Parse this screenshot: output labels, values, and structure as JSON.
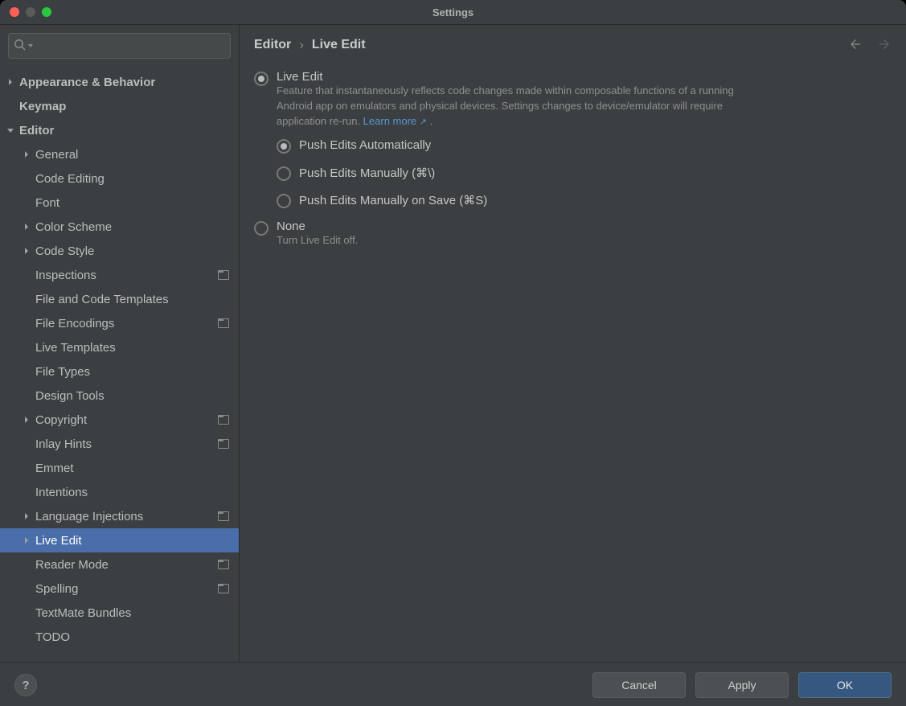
{
  "window": {
    "title": "Settings"
  },
  "sidebar": {
    "search_placeholder": "",
    "items": [
      {
        "label": "Appearance & Behavior",
        "depth": 0,
        "chevron": "right",
        "bold": true
      },
      {
        "label": "Keymap",
        "depth": 0,
        "bold": true
      },
      {
        "label": "Editor",
        "depth": 0,
        "chevron": "down",
        "bold": true
      },
      {
        "label": "General",
        "depth": 1,
        "chevron": "right"
      },
      {
        "label": "Code Editing",
        "depth": 1
      },
      {
        "label": "Font",
        "depth": 1
      },
      {
        "label": "Color Scheme",
        "depth": 1,
        "chevron": "right"
      },
      {
        "label": "Code Style",
        "depth": 1,
        "chevron": "right"
      },
      {
        "label": "Inspections",
        "depth": 1,
        "badge": true
      },
      {
        "label": "File and Code Templates",
        "depth": 1
      },
      {
        "label": "File Encodings",
        "depth": 1,
        "badge": true
      },
      {
        "label": "Live Templates",
        "depth": 1
      },
      {
        "label": "File Types",
        "depth": 1
      },
      {
        "label": "Design Tools",
        "depth": 1
      },
      {
        "label": "Copyright",
        "depth": 1,
        "chevron": "right",
        "badge": true
      },
      {
        "label": "Inlay Hints",
        "depth": 1,
        "badge": true
      },
      {
        "label": "Emmet",
        "depth": 1
      },
      {
        "label": "Intentions",
        "depth": 1
      },
      {
        "label": "Language Injections",
        "depth": 1,
        "chevron": "right",
        "badge": true
      },
      {
        "label": "Live Edit",
        "depth": 1,
        "chevron": "right",
        "selected": true
      },
      {
        "label": "Reader Mode",
        "depth": 1,
        "badge": true
      },
      {
        "label": "Spelling",
        "depth": 1,
        "badge": true
      },
      {
        "label": "TextMate Bundles",
        "depth": 1
      },
      {
        "label": "TODO",
        "depth": 1
      }
    ]
  },
  "breadcrumb": {
    "part1": "Editor",
    "sep": "›",
    "part2": "Live Edit"
  },
  "options": {
    "liveEdit": {
      "label": "Live Edit",
      "desc_before": "Feature that instantaneously reflects code changes made within composable functions of a running Android app on emulators and physical devices. Settings changes to device/emulator will require application re-run. ",
      "learn_more": "Learn more",
      "period": " .",
      "checked": true,
      "sub": [
        {
          "label": "Push Edits Automatically",
          "checked": true
        },
        {
          "label": "Push Edits Manually (⌘\\)",
          "checked": false
        },
        {
          "label": "Push Edits Manually on Save (⌘S)",
          "checked": false
        }
      ]
    },
    "none": {
      "label": "None",
      "desc": "Turn Live Edit off.",
      "checked": false
    }
  },
  "footer": {
    "cancel": "Cancel",
    "apply": "Apply",
    "ok": "OK",
    "help": "?"
  }
}
